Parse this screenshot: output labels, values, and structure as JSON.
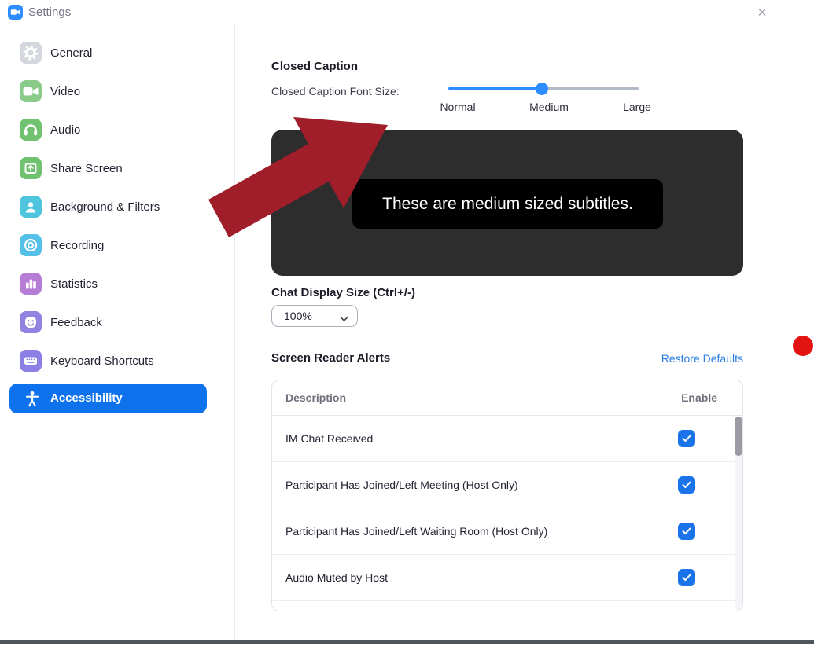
{
  "window": {
    "title": "Settings",
    "close_label": "✕"
  },
  "sidebar": {
    "items": [
      {
        "label": "General",
        "icon": "gear-icon",
        "color": "#d4d7dd"
      },
      {
        "label": "Video",
        "icon": "video-camera-icon",
        "color": "#8acb8a"
      },
      {
        "label": "Audio",
        "icon": "headphones-icon",
        "color": "#70c170"
      },
      {
        "label": "Share Screen",
        "icon": "share-screen-icon",
        "color": "#70c170"
      },
      {
        "label": "Background & Filters",
        "icon": "person-portrait-icon",
        "color": "#4fc4de"
      },
      {
        "label": "Recording",
        "icon": "record-icon",
        "color": "#55c0e8"
      },
      {
        "label": "Statistics",
        "icon": "bar-chart-icon",
        "color": "#b67dd6"
      },
      {
        "label": "Feedback",
        "icon": "smiley-icon",
        "color": "#9083e2"
      },
      {
        "label": "Keyboard Shortcuts",
        "icon": "keyboard-icon",
        "color": "#8b7fe6"
      },
      {
        "label": "Accessibility",
        "icon": "accessibility-icon",
        "selected": true
      }
    ]
  },
  "closed_caption": {
    "heading": "Closed Caption",
    "font_size_label": "Closed Caption Font Size:",
    "slider_options": [
      "Normal",
      "Medium",
      "Large"
    ],
    "slider_value": "Medium",
    "preview_text": "These are medium sized subtitles."
  },
  "chat_display": {
    "heading": "Chat Display Size (Ctrl+/-)",
    "selected_value": "100%"
  },
  "screen_reader_alerts": {
    "heading": "Screen Reader Alerts",
    "restore_defaults_label": "Restore Defaults",
    "columns": {
      "description": "Description",
      "enable": "Enable"
    },
    "rows": [
      {
        "description": "IM Chat Received",
        "enabled": true
      },
      {
        "description": "Participant Has Joined/Left Meeting (Host Only)",
        "enabled": true
      },
      {
        "description": "Participant Has Joined/Left Waiting Room (Host Only)",
        "enabled": true
      },
      {
        "description": "Audio Muted by Host",
        "enabled": true
      }
    ]
  },
  "colors": {
    "accent": "#0e72ed",
    "slider_active": "#2d8cff",
    "slider_inactive": "#b3bac6",
    "link": "#2a7de1",
    "checkbox": "#1a73e8",
    "arrow_red": "#a01d2a",
    "dot_red": "#e31313",
    "preview_bg": "#2d2d2d",
    "caption_bg": "#000000",
    "titlebar_text": "#747487",
    "bottom_bar": "#4d575a"
  }
}
